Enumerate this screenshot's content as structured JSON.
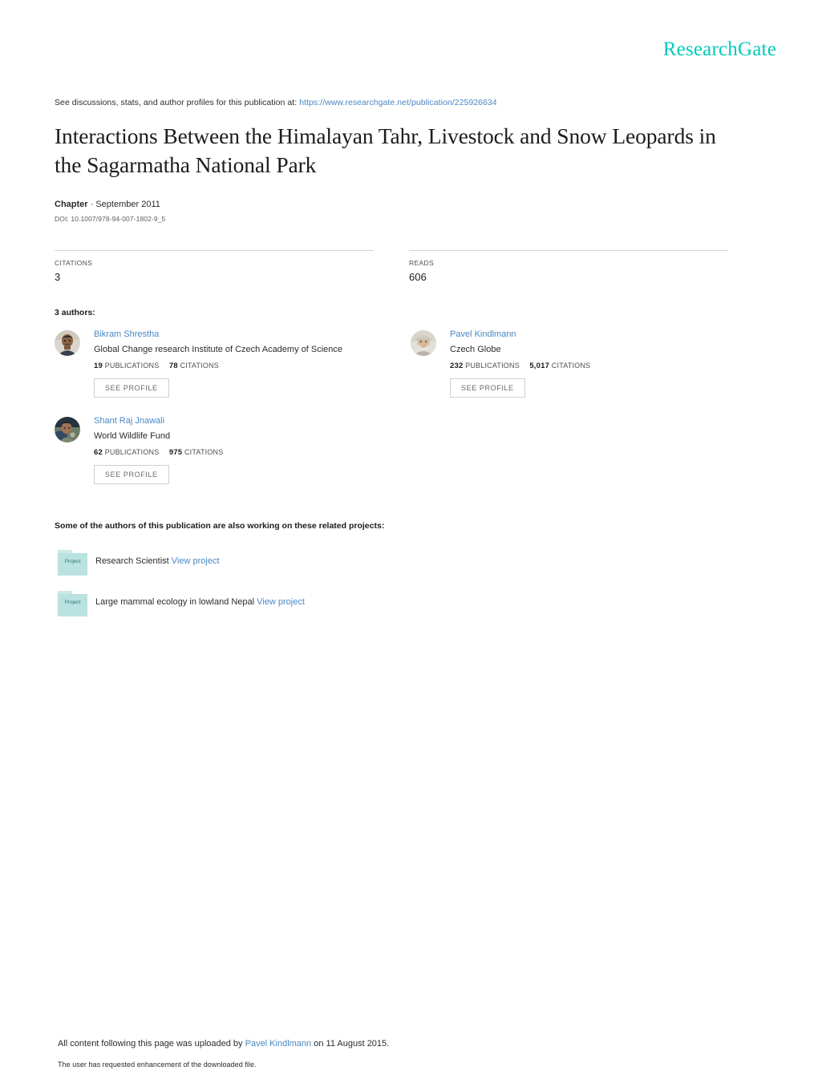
{
  "brand": {
    "logo_text": "ResearchGate",
    "logo_color": "#00ccbb"
  },
  "header": {
    "discussions_prefix": "See discussions, stats, and author profiles for this publication at:",
    "publication_url": "https://www.researchgate.net/publication/225926634"
  },
  "publication": {
    "title": "Interactions Between the Himalayan Tahr, Livestock and Snow Leopards in the Sagarmatha National Park",
    "type_label": "Chapter",
    "type_separator": " · ",
    "date": "September 2011",
    "doi": "DOI: 10.1007/978-94-007-1802-9_5"
  },
  "stats": {
    "citations_label": "CITATIONS",
    "citations_value": "3",
    "reads_label": "READS",
    "reads_value": "606"
  },
  "authors_section": {
    "heading": "3 authors:",
    "see_profile_label": "SEE PROFILE",
    "publications_word": "PUBLICATIONS",
    "citations_word": "CITATIONS",
    "authors": [
      {
        "name": "Bikram Shrestha",
        "affiliation": "Global Change research Institute of Czech Academy of Science",
        "publications": "19",
        "citations": "78"
      },
      {
        "name": "Pavel Kindlmann",
        "affiliation": "Czech Globe",
        "publications": "232",
        "citations": "5,017"
      },
      {
        "name": "Shant Raj Jnawali",
        "affiliation": "World Wildlife Fund",
        "publications": "62",
        "citations": "975"
      }
    ]
  },
  "projects_section": {
    "heading": "Some of the authors of this publication are also working on these related projects:",
    "icon_glyph_text": "Project",
    "view_project_label": "View project",
    "projects": [
      {
        "title": "Research Scientist"
      },
      {
        "title": "Large mammal ecology in lowland Nepal"
      }
    ]
  },
  "footer": {
    "upload_prefix": "All content following this page was uploaded by ",
    "uploader_name": "Pavel Kindlmann",
    "upload_suffix": " on 11 August 2015.",
    "enhancement_note": "The user has requested enhancement of the downloaded file."
  }
}
